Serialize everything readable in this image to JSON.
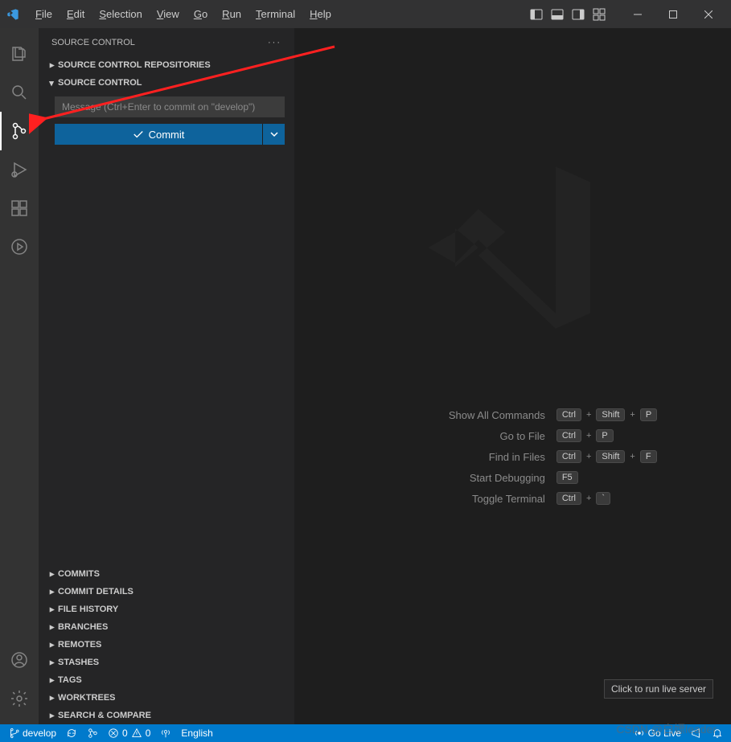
{
  "menu": [
    "File",
    "Edit",
    "Selection",
    "View",
    "Go",
    "Run",
    "Terminal",
    "Help"
  ],
  "sidebar": {
    "title": "SOURCE CONTROL",
    "repo_section": "SOURCE CONTROL REPOSITORIES",
    "main_section": "SOURCE CONTROL",
    "commit_placeholder": "Message (Ctrl+Enter to commit on \"develop\")",
    "commit_label": "Commit",
    "bottom_sections": [
      "COMMITS",
      "COMMIT DETAILS",
      "FILE HISTORY",
      "BRANCHES",
      "REMOTES",
      "STASHES",
      "TAGS",
      "WORKTREES",
      "SEARCH & COMPARE"
    ]
  },
  "shortcuts": [
    {
      "label": "Show All Commands",
      "keys": [
        "Ctrl",
        "+",
        "Shift",
        "+",
        "P"
      ]
    },
    {
      "label": "Go to File",
      "keys": [
        "Ctrl",
        "+",
        "P"
      ]
    },
    {
      "label": "Find in Files",
      "keys": [
        "Ctrl",
        "+",
        "Shift",
        "+",
        "F"
      ]
    },
    {
      "label": "Start Debugging",
      "keys": [
        "F5"
      ]
    },
    {
      "label": "Toggle Terminal",
      "keys": [
        "Ctrl",
        "+",
        "`"
      ]
    }
  ],
  "tooltip": "Click to run live server",
  "status": {
    "branch": "develop",
    "errors": "0",
    "warnings": "0",
    "language": "English",
    "golive": "Go Live"
  },
  "watermark": "CSDN @白嫖leader"
}
